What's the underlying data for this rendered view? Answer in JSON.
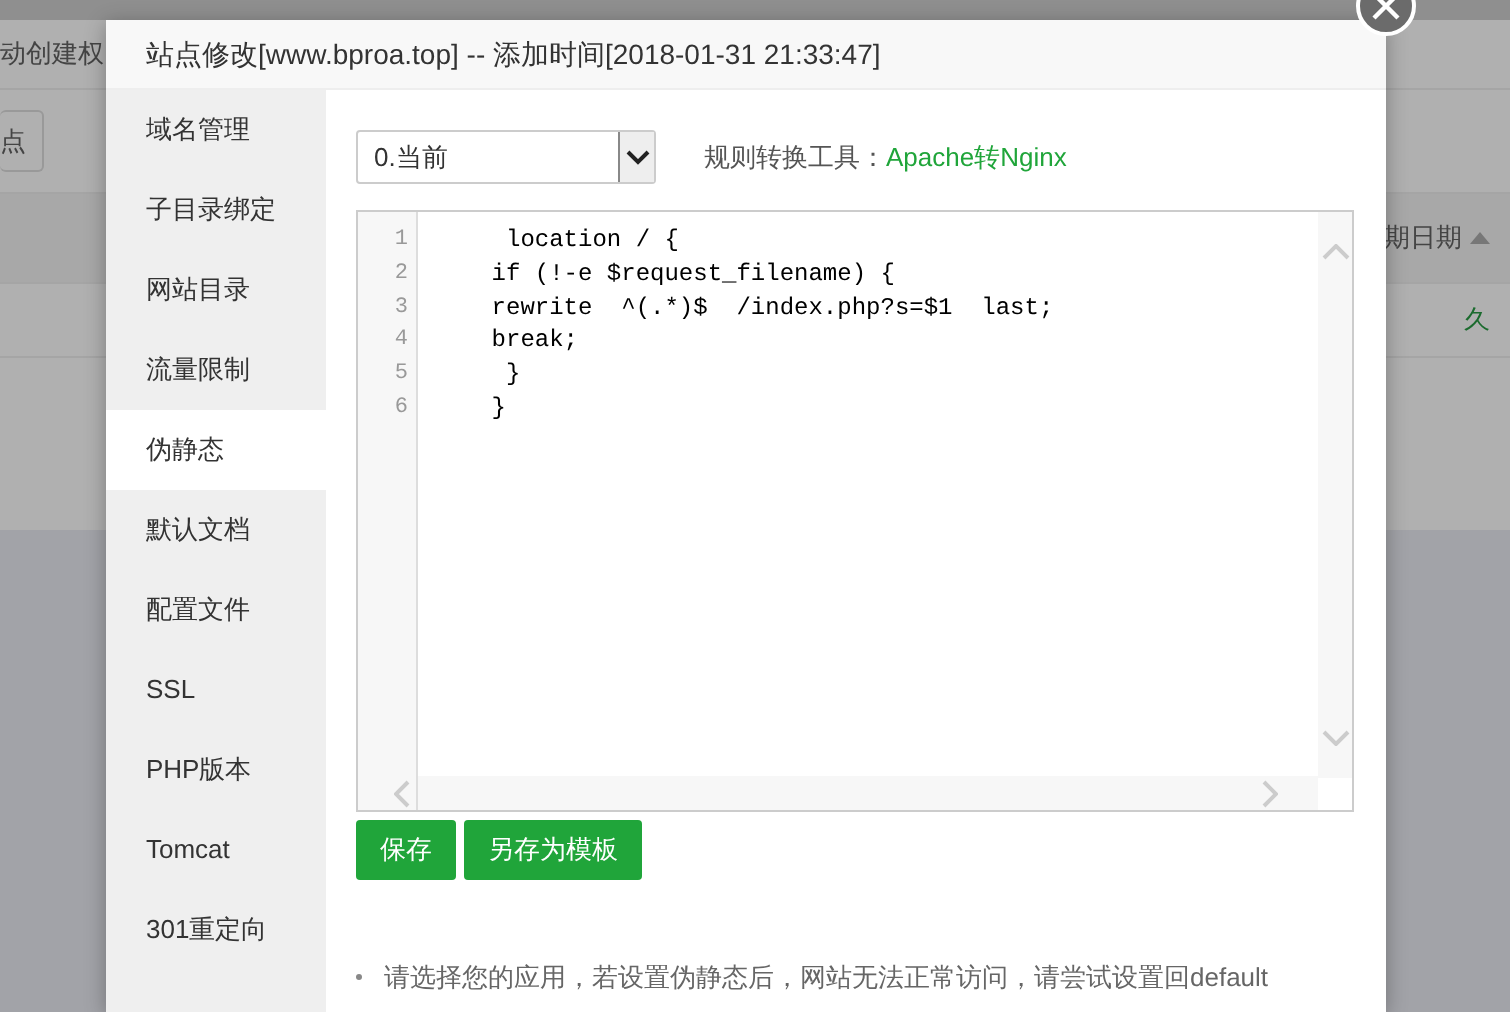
{
  "background_page": {
    "toolbar_text": "动创建权",
    "button_label": "点",
    "column_right": "期日期",
    "status_right": "久"
  },
  "dialog": {
    "title": "站点修改[www.bproa.top] -- 添加时间[2018-01-31 21:33:47]",
    "sidebar": {
      "items": [
        {
          "label": "域名管理",
          "selected": false
        },
        {
          "label": "子目录绑定",
          "selected": false
        },
        {
          "label": "网站目录",
          "selected": false
        },
        {
          "label": "流量限制",
          "selected": false
        },
        {
          "label": "伪静态",
          "selected": true
        },
        {
          "label": "默认文档",
          "selected": false
        },
        {
          "label": "配置文件",
          "selected": false
        },
        {
          "label": "SSL",
          "selected": false
        },
        {
          "label": "PHP版本",
          "selected": false
        },
        {
          "label": "Tomcat",
          "selected": false
        },
        {
          "label": "301重定向",
          "selected": false
        }
      ]
    },
    "template_select": {
      "value": "0.当前"
    },
    "converter": {
      "label": "规则转换工具：",
      "link": "Apache转Nginx"
    },
    "editor": {
      "lines": [
        {
          "number": "1",
          "code": "     location / {"
        },
        {
          "number": "2",
          "code": "    if (!-e $request_filename) {"
        },
        {
          "number": "3",
          "code": "    rewrite  ^(.*)$  /index.php?s=$1  last;"
        },
        {
          "number": "4",
          "code": "    break;"
        },
        {
          "number": "5",
          "code": "     }"
        },
        {
          "number": "6",
          "code": "    }"
        }
      ]
    },
    "buttons": [
      "保存",
      "另存为模板"
    ],
    "notes": [
      "请选择您的应用，若设置伪静态后，网站无法正常访问，请尝试设置回default"
    ]
  }
}
